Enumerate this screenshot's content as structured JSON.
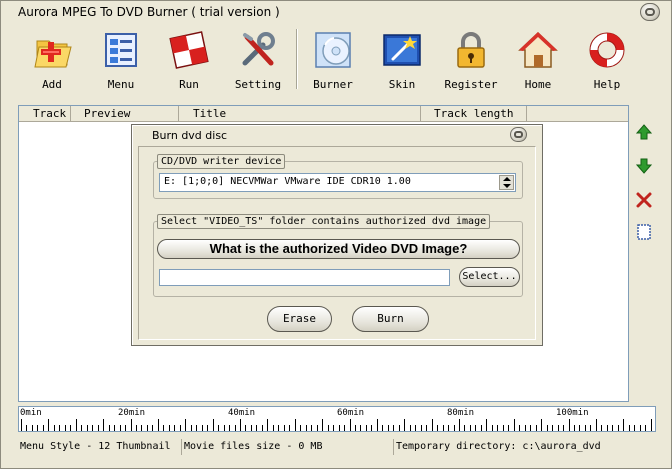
{
  "window": {
    "title": "Aurora MPEG To DVD Burner  ( trial version )"
  },
  "toolbar": {
    "add": "Add",
    "menu": "Menu",
    "run": "Run",
    "setting": "Setting",
    "burner": "Burner",
    "skin": "Skin",
    "register": "Register",
    "home": "Home",
    "help": "Help"
  },
  "tracklist": {
    "columns": [
      "Track",
      "Preview",
      "Title",
      "Track length"
    ]
  },
  "side_buttons": [
    "arrow-up-icon",
    "arrow-down-icon",
    "delete-icon",
    "properties-icon"
  ],
  "dialog": {
    "title": "Burn dvd disc",
    "writer_group": "CD/DVD writer device",
    "writer_value": "E: [1;0;0] NECVMWar VMware IDE CDR10 1.00",
    "folder_group": "Select \"VIDEO_TS\" folder contains authorized dvd image",
    "auth_button": "What is the authorized Video DVD Image?",
    "path_value": "",
    "select_button": "Select...",
    "erase_button": "Erase",
    "burn_button": "Burn"
  },
  "timeline": {
    "labels": [
      "0min",
      "20min",
      "40min",
      "60min",
      "80min",
      "100min"
    ]
  },
  "status": {
    "menu_style": "Menu Style - 12 Thumbnail",
    "file_size": "Movie files size - 0 MB",
    "temp_dir": "Temporary directory: c:\\aurora_dvd"
  },
  "colors": {
    "window_bg": "#ece9d8",
    "list_border": "#7f9db9",
    "up_arrow": "#2e9a2e",
    "down_arrow": "#2e9a2e",
    "delete": "#c0241e"
  }
}
